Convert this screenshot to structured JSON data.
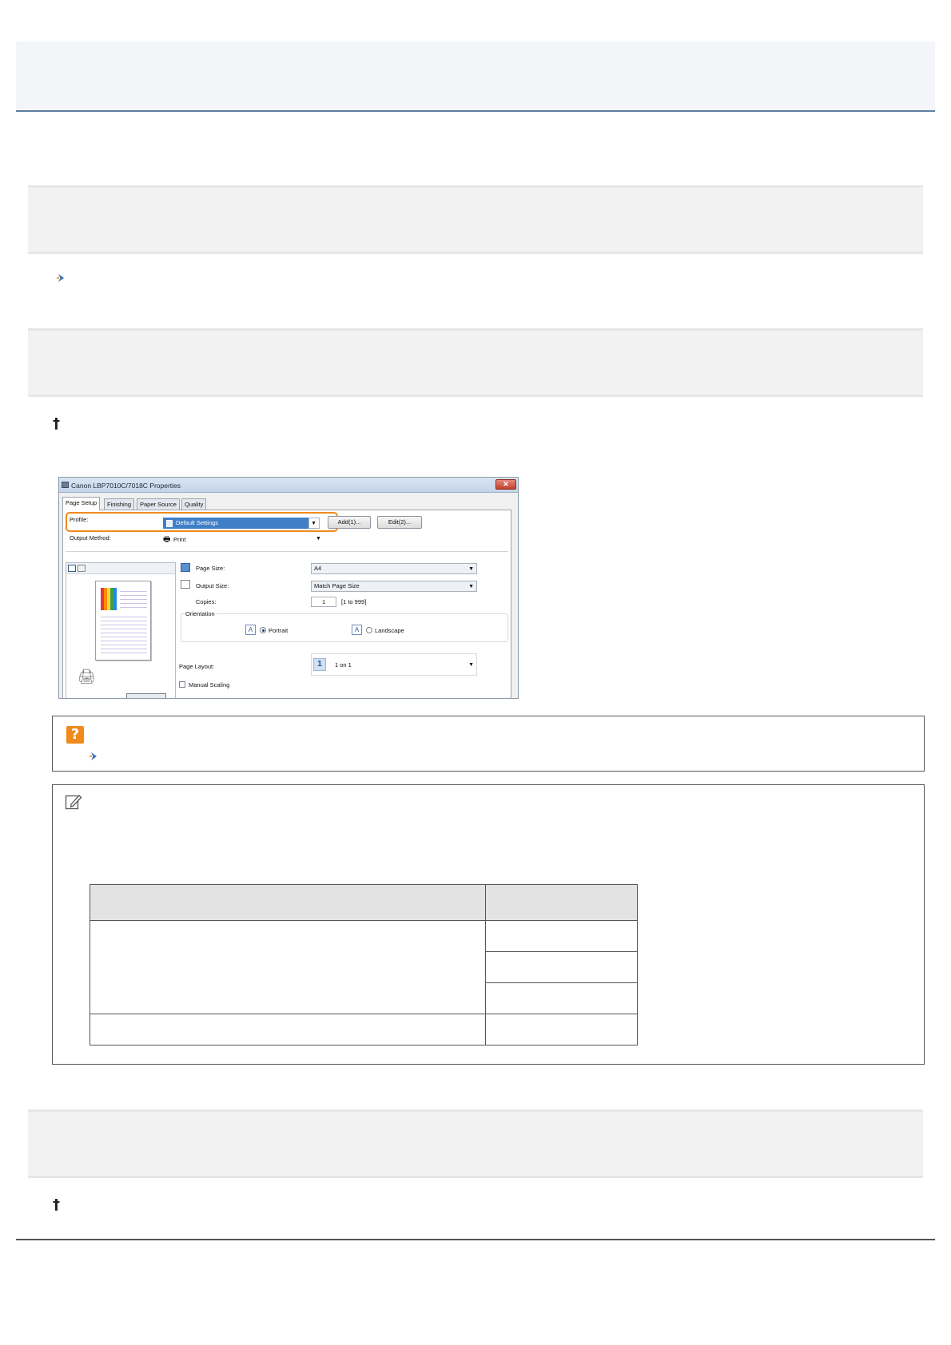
{
  "dialog": {
    "title": "Canon LBP7010C/7018C Properties",
    "close_label": "✕",
    "tabs": [
      "Page Setup",
      "Finishing",
      "Paper Source",
      "Quality"
    ],
    "profile_label": "Profile:",
    "profile_value": "Default Settings",
    "add_button": "Add(1)...",
    "edit_button": "Edit(2)...",
    "output_method_label": "Output Method:",
    "output_method_value": "Print",
    "page_size_label": "Page Size:",
    "page_size_value": "A4",
    "output_size_label": "Output Size:",
    "output_size_value": "Match Page Size",
    "copies_label": "Copies:",
    "copies_value": "1",
    "copies_range": "[1 to 999]",
    "orientation_label": "Orientation",
    "portrait_label": "Portrait",
    "landscape_label": "Landscape",
    "orientation_glyph": "A",
    "page_layout_label": "Page Layout:",
    "page_layout_icon_text": "1",
    "page_layout_value": "1 on 1",
    "manual_scaling_label": "Manual Scaling",
    "orientation_selected": "Portrait"
  },
  "icons": {
    "bullet": "chevron-right-icon",
    "dagger": "†",
    "help": "?",
    "note": "pencil-note-icon"
  },
  "colors": {
    "highlight": "#f08a1c",
    "header_rule": "#5b7fa0",
    "band_bg": "#f2f2f2"
  }
}
